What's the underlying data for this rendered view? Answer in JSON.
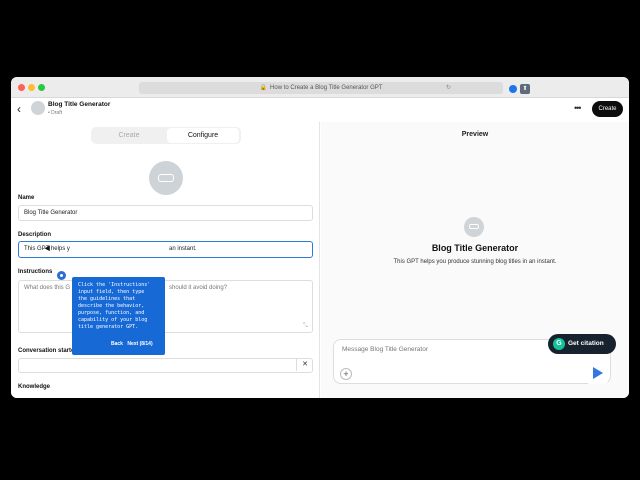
{
  "browser": {
    "url_text": "How to Create a Blog Title Generator GPT",
    "lock_glyph": "🔒",
    "reload_glyph": "↻",
    "ext2_glyph": "⬆",
    "traffic_colors": [
      "#fe5f57",
      "#febc2e",
      "#28c840"
    ]
  },
  "header": {
    "back_glyph": "‹",
    "title": "Blog Title Generator",
    "status": "• Draft",
    "more_glyph": "•••",
    "create_label": "Create"
  },
  "tabs": {
    "create_label": "Create",
    "configure_label": "Configure",
    "active": "Configure"
  },
  "form": {
    "name_label": "Name",
    "name_value": "Blog Title Generator",
    "description_label": "Description",
    "description_value": "This GPT helps y",
    "description_value_tail": "an instant.",
    "instructions_label": "Instructions",
    "instructions_placeholder": "What does this G",
    "instructions_placeholder_tail": "should it avoid doing?",
    "resize_glyph": "⤡",
    "starters_label": "Conversation starters",
    "starter_remove_glyph": "✕",
    "knowledge_label": "Knowledge"
  },
  "tooltip": {
    "text": "Click the 'Instructions'\ninput field, then type\nthe guidelines that\ndescribe the behavior,\npurpose, function, and\ncapability of your blog\ntitle generator GPT.",
    "back_label": "Back",
    "next_label": "Next (8/14)"
  },
  "preview": {
    "title": "Preview",
    "gpt_name": "Blog Title Generator",
    "gpt_description": "This GPT helps you produce stunning blog titles in an instant.",
    "message_placeholder": "Message Blog Title Generator",
    "plus_glyph": "+",
    "citation_icon_letter": "G",
    "citation_label": "Get citation"
  },
  "colors": {
    "accent_blue": "#1769d6",
    "citation_bg": "#17222f",
    "grammarly_green": "#15c39a",
    "create_button": "#0d0d0d"
  }
}
